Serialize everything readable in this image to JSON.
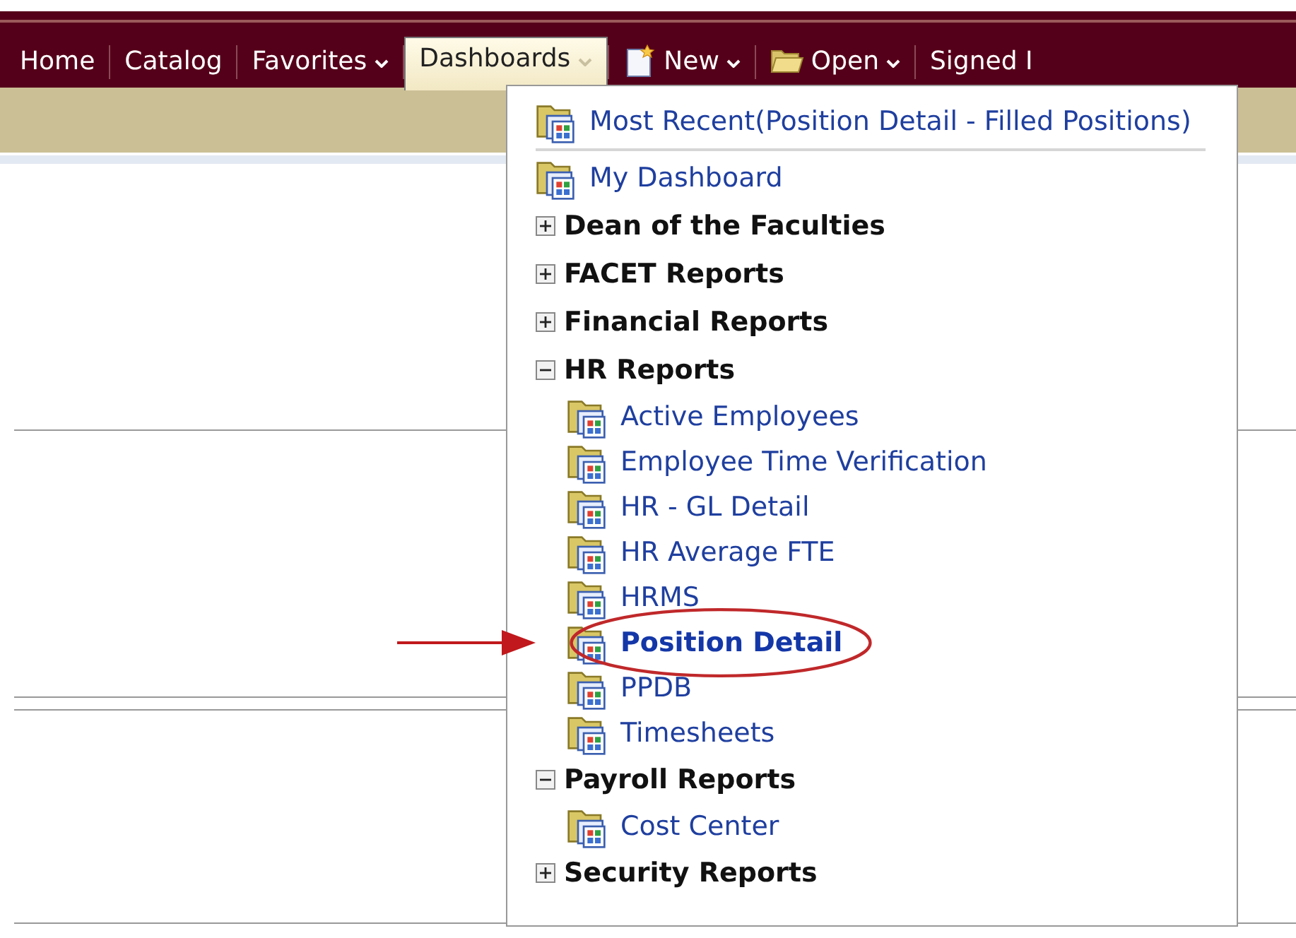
{
  "nav": {
    "items": [
      {
        "kind": "text",
        "label": "Home",
        "selected": false,
        "caret": false
      },
      {
        "kind": "text",
        "label": "Catalog",
        "selected": false,
        "caret": false
      },
      {
        "kind": "text",
        "label": "Favorites",
        "selected": false,
        "caret": true
      },
      {
        "kind": "text",
        "label": "Dashboards",
        "selected": true,
        "caret": true
      },
      {
        "kind": "new",
        "label": "New",
        "selected": false,
        "caret": true
      },
      {
        "kind": "open",
        "label": "Open",
        "selected": false,
        "caret": true
      },
      {
        "kind": "text",
        "label": "Signed I",
        "selected": false,
        "caret": false
      }
    ]
  },
  "menu": {
    "recent": {
      "label": "Most Recent(Position Detail - Filled Positions)"
    },
    "items": [
      {
        "kind": "dashboard",
        "label": "My Dashboard",
        "selected": false
      },
      {
        "kind": "folder",
        "label": "Dean of the Faculties",
        "expanded": false
      },
      {
        "kind": "folder",
        "label": "FACET Reports",
        "expanded": false
      },
      {
        "kind": "folder",
        "label": "Financial Reports",
        "expanded": false
      },
      {
        "kind": "folder",
        "label": "HR Reports",
        "expanded": true,
        "children": [
          {
            "label": "Active Employees",
            "selected": false
          },
          {
            "label": "Employee Time Verification",
            "selected": false
          },
          {
            "label": "HR - GL Detail",
            "selected": false
          },
          {
            "label": "HR Average FTE",
            "selected": false
          },
          {
            "label": "HRMS",
            "selected": false
          },
          {
            "label": "Position Detail",
            "selected": true
          },
          {
            "label": "PPDB",
            "selected": false
          },
          {
            "label": "Timesheets",
            "selected": false
          }
        ]
      },
      {
        "kind": "folder",
        "label": "Payroll Reports",
        "expanded": true,
        "children": [
          {
            "label": "Cost Center",
            "selected": false
          }
        ]
      },
      {
        "kind": "folder",
        "label": "Security Reports",
        "expanded": false
      }
    ]
  }
}
